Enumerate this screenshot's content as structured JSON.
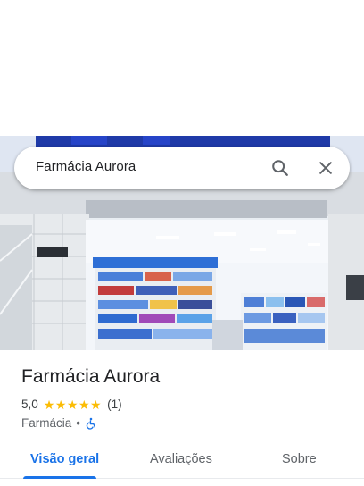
{
  "search": {
    "query": "Farmácia Aurora"
  },
  "place": {
    "name": "Farmácia Aurora",
    "rating": "5,0",
    "stars": 5,
    "review_count": "(1)",
    "category": "Farmácia",
    "separator": "•",
    "accessibility_icon": "wheelchair-accessible-icon"
  },
  "tabs": [
    {
      "label": "Visão geral",
      "active": true
    },
    {
      "label": "Avaliações",
      "active": false
    },
    {
      "label": "Sobre",
      "active": false
    }
  ],
  "colors": {
    "accent": "#1a73e8",
    "star": "#fbbc04",
    "text": "#202124",
    "muted": "#5f6368"
  }
}
